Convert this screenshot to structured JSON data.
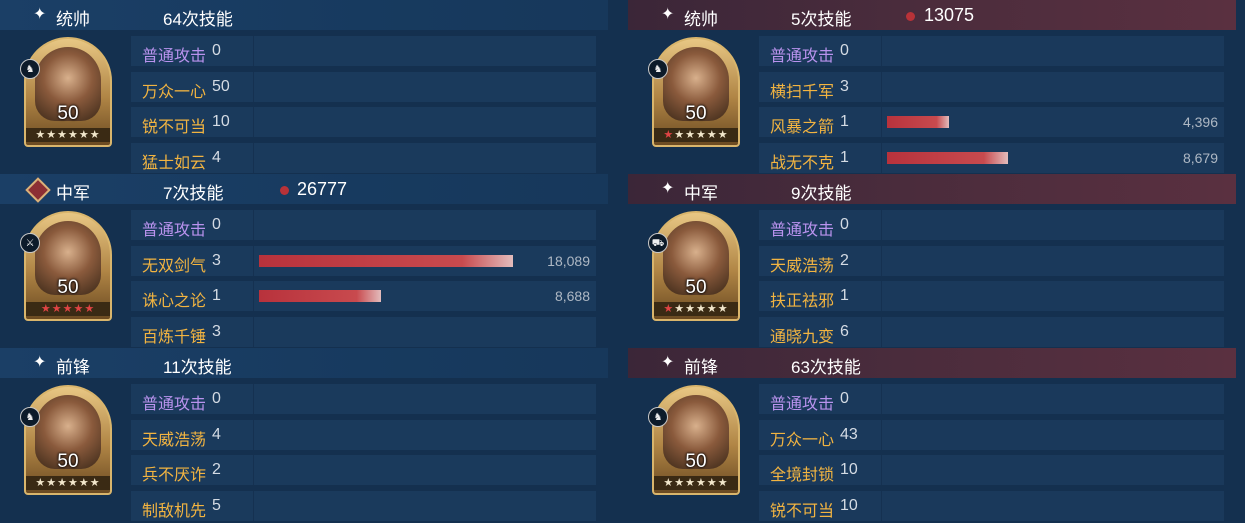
{
  "panels": [
    {
      "side": "left",
      "role": "统帅",
      "count": "64次技能",
      "damage": "",
      "portrait": {
        "level": "50",
        "badge_icon": "cavalry-icon",
        "stars": "★★★★★★",
        "red_stars": 0
      },
      "rows": [
        {
          "name": "普通攻击",
          "type": "normal",
          "times": "0",
          "value": "",
          "bar": 0
        },
        {
          "name": "万众一心",
          "type": "skill",
          "times": "50",
          "value": "",
          "bar": 0
        },
        {
          "name": "锐不可当",
          "type": "skill",
          "times": "10",
          "value": "",
          "bar": 0
        },
        {
          "name": "猛士如云",
          "type": "skill",
          "times": "4",
          "value": "",
          "bar": 0
        }
      ]
    },
    {
      "side": "left",
      "role": "中军",
      "count": "7次技能",
      "damage": "26777",
      "portrait": {
        "level": "50",
        "badge_icon": "sword-icon",
        "stars": "★★★★★",
        "red_stars": 5
      },
      "rows": [
        {
          "name": "普通攻击",
          "type": "normal",
          "times": "0",
          "value": "",
          "bar": 0
        },
        {
          "name": "无双剑气",
          "type": "skill",
          "times": "3",
          "value": "18,089",
          "bar": 1.0
        },
        {
          "name": "诛心之论",
          "type": "skill",
          "times": "1",
          "value": "8,688",
          "bar": 0.48
        },
        {
          "name": "百炼千锤",
          "type": "skill",
          "times": "3",
          "value": "",
          "bar": 0
        }
      ]
    },
    {
      "side": "left",
      "role": "前锋",
      "count": "11次技能",
      "damage": "",
      "portrait": {
        "level": "50",
        "badge_icon": "cavalry-icon",
        "stars": "★★★★★★",
        "red_stars": 0
      },
      "rows": [
        {
          "name": "普通攻击",
          "type": "normal",
          "times": "0",
          "value": "",
          "bar": 0
        },
        {
          "name": "天威浩荡",
          "type": "skill",
          "times": "4",
          "value": "",
          "bar": 0
        },
        {
          "name": "兵不厌诈",
          "type": "skill",
          "times": "2",
          "value": "",
          "bar": 0
        },
        {
          "name": "制敌机先",
          "type": "skill",
          "times": "5",
          "value": "",
          "bar": 0
        }
      ]
    },
    {
      "side": "right",
      "role": "统帅",
      "count": "5次技能",
      "damage": "13075",
      "portrait": {
        "level": "50",
        "badge_icon": "cavalry-icon",
        "stars": "★★★★★★",
        "red_stars": 1
      },
      "rows": [
        {
          "name": "普通攻击",
          "type": "normal",
          "times": "0",
          "value": "",
          "bar": 0
        },
        {
          "name": "横扫千军",
          "type": "skill",
          "times": "3",
          "value": "",
          "bar": 0
        },
        {
          "name": "风暴之箭",
          "type": "skill",
          "times": "1",
          "value": "4,396",
          "bar": 0.51
        },
        {
          "name": "战无不克",
          "type": "skill",
          "times": "1",
          "value": "8,679",
          "bar": 1.0
        }
      ]
    },
    {
      "side": "right",
      "role": "中军",
      "count": "9次技能",
      "damage": "",
      "portrait": {
        "level": "50",
        "badge_icon": "chariot-icon",
        "stars": "★★★★★★",
        "red_stars": 1
      },
      "rows": [
        {
          "name": "普通攻击",
          "type": "normal",
          "times": "0",
          "value": "",
          "bar": 0
        },
        {
          "name": "天威浩荡",
          "type": "skill",
          "times": "2",
          "value": "",
          "bar": 0
        },
        {
          "name": "扶正祛邪",
          "type": "skill",
          "times": "1",
          "value": "",
          "bar": 0
        },
        {
          "name": "通晓九变",
          "type": "skill",
          "times": "6",
          "value": "",
          "bar": 0
        }
      ]
    },
    {
      "side": "right",
      "role": "前锋",
      "count": "63次技能",
      "damage": "",
      "portrait": {
        "level": "50",
        "badge_icon": "cavalry-icon",
        "stars": "★★★★★★",
        "red_stars": 0
      },
      "rows": [
        {
          "name": "普通攻击",
          "type": "normal",
          "times": "0",
          "value": "",
          "bar": 0
        },
        {
          "name": "万众一心",
          "type": "skill",
          "times": "43",
          "value": "",
          "bar": 0
        },
        {
          "name": "全境封锁",
          "type": "skill",
          "times": "10",
          "value": "",
          "bar": 0
        },
        {
          "name": "锐不可当",
          "type": "skill",
          "times": "10",
          "value": "",
          "bar": 0
        }
      ]
    }
  ],
  "colors": {
    "normal_skill": "#b993ee",
    "skill": "#f2b441",
    "bar": "#b8323c",
    "damage_dot": "#b83238"
  }
}
